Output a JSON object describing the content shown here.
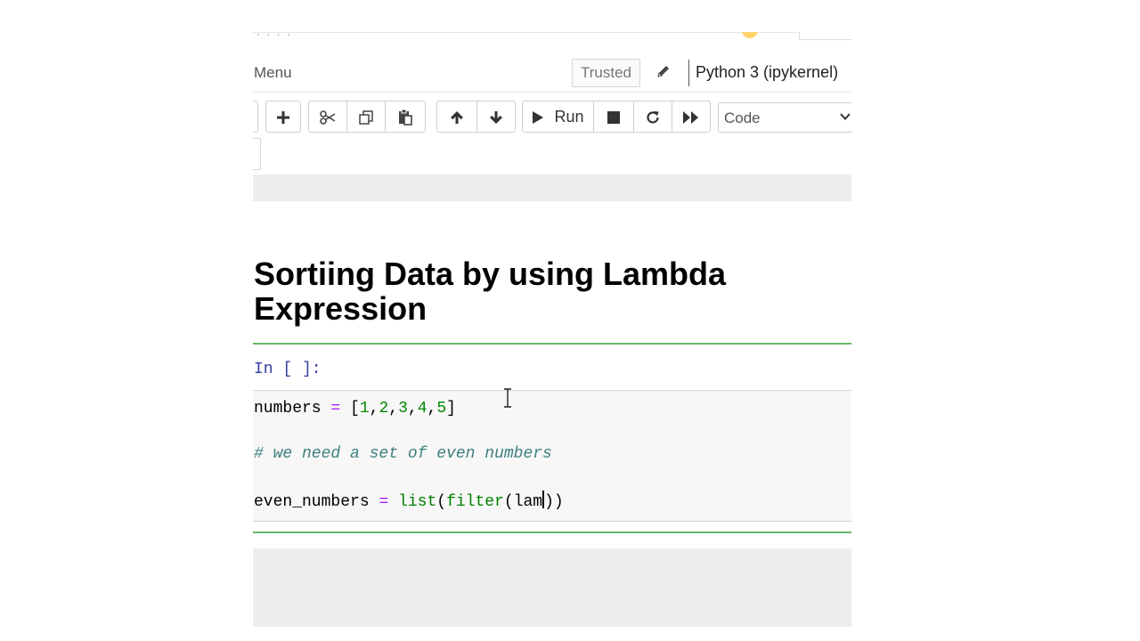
{
  "header": {
    "menu_label": "Menu",
    "trusted_label": "Trusted",
    "kernel_name": "Python 3 (ipykernel)"
  },
  "toolbar": {
    "buttons": [
      {
        "name": "insert-cell-below-button",
        "icon": "plus-icon"
      },
      {
        "name": "cut-cells-button",
        "icon": "scissors-icon"
      },
      {
        "name": "copy-cells-button",
        "icon": "copy-icon"
      },
      {
        "name": "paste-cells-button",
        "icon": "paste-icon"
      },
      {
        "name": "move-cell-up-button",
        "icon": "arrow-up-icon"
      },
      {
        "name": "move-cell-down-button",
        "icon": "arrow-down-icon"
      },
      {
        "name": "run-button",
        "icon": "play-icon"
      },
      {
        "name": "interrupt-kernel-button",
        "icon": "stop-icon"
      },
      {
        "name": "restart-kernel-button",
        "icon": "restart-icon"
      },
      {
        "name": "restart-run-all-button",
        "icon": "fast-forward-icon"
      }
    ],
    "run_label": "Run",
    "cell_type": "Code"
  },
  "notebook": {
    "heading": "Sortiing Data by using Lambda Expression",
    "code_cell": {
      "prompt": "In [ ]:",
      "lines": [
        "numbers = [1,2,3,4,5]",
        "# we need a set of even numbers",
        "even_numbers = list(filter(lam))"
      ]
    }
  },
  "colors": {
    "selected_cell_border": "#66bb6a",
    "prompt_color": "#303f9f",
    "number_color": "#008800",
    "operator_color": "#aa22ff",
    "comment_color": "#408080"
  }
}
